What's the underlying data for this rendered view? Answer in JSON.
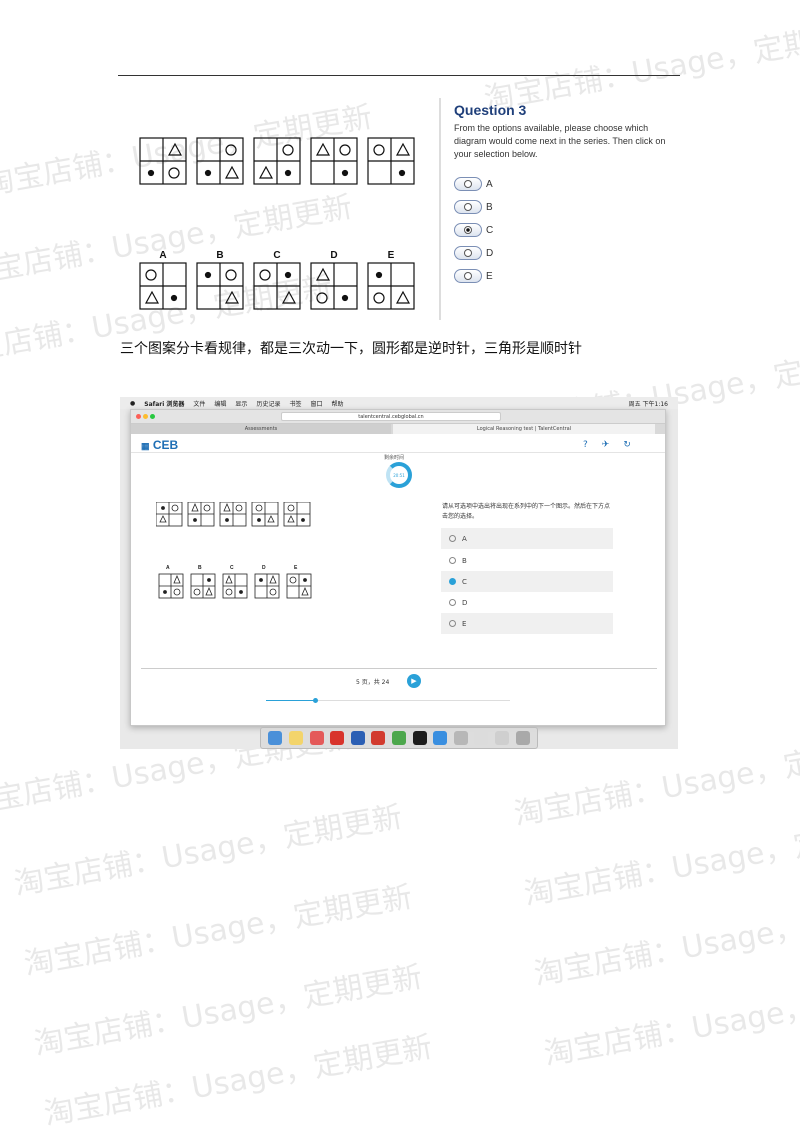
{
  "question": {
    "title": "Question 3",
    "instructions": "From the options available, please choose which diagram would come next in the series. Then click on your selection below.",
    "options": [
      "A",
      "B",
      "C",
      "D",
      "E"
    ],
    "selected": "C"
  },
  "answer_letters": [
    "A",
    "B",
    "C",
    "D",
    "E"
  ],
  "caption": "三个图案分卡看规律，都是三次动一下，圆形都是逆时针，三角形是顺时针",
  "watermark": "淘宝店铺：Usage，定期更新",
  "screenshot": {
    "menubar": [
      "Safari 浏览器",
      "文件",
      "编辑",
      "显示",
      "历史记录",
      "书签",
      "窗口",
      "帮助"
    ],
    "menubar_right": "周五 下午1:16",
    "url": "talentcentral.cebglobal.cn",
    "tab_left": "Assessments",
    "tab_right": "Logical Reasoning test | TalentCentral",
    "logo": "CEB",
    "timer_label": "剩余时间",
    "timer_value": "20:51",
    "question_text": "请从可选项中选出将出现在系列中的下一个图示。然后在下方点击您的选择。",
    "options": [
      "A",
      "B",
      "C",
      "D",
      "E"
    ],
    "selected": "C",
    "page_text": "5 页，共 24",
    "progress": 0.2
  }
}
